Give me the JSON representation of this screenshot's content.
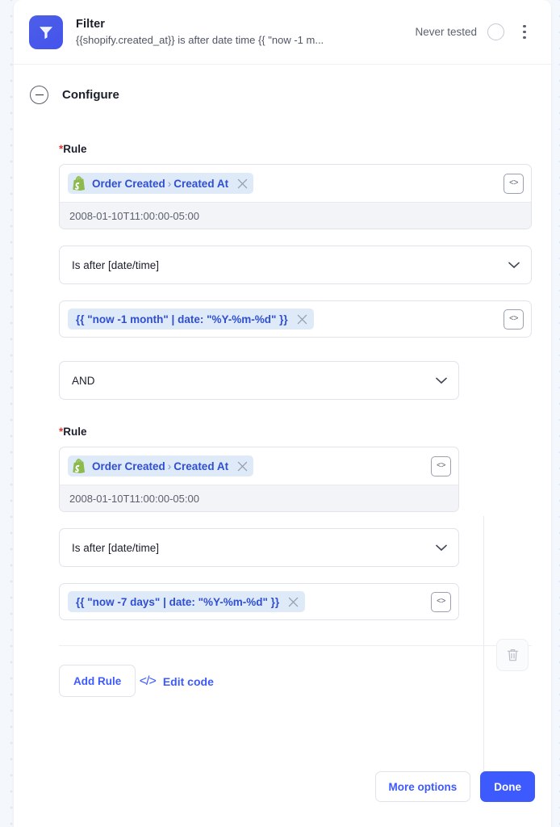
{
  "header": {
    "title": "Filter",
    "subtitle": "{{shopify.created_at}} is after date time {{ \"now -1 m...",
    "status": "Never tested",
    "app_icon": "filter-icon",
    "status_icon": "empty-circle-icon",
    "menu_icon": "kebab-menu-icon"
  },
  "section": {
    "title": "Configure",
    "collapse_icon": "circle-minus-icon"
  },
  "rules": [
    {
      "label": "Rule",
      "required_mark": "*",
      "source_icon": "shopify-icon",
      "token_prefix": "Order Created",
      "token_separator": "›",
      "token_suffix": "Created At",
      "remove_icon": "close-icon",
      "code_icon": "code-brackets-icon",
      "sample_value": "2008-01-10T11:00:00-05:00",
      "operator": "Is after [date/time]",
      "operator_chevron": "chevron-down-icon",
      "value_token": "{{ \"now -1 month\" | date: \"%Y-%m-%d\" }}",
      "value_remove_icon": "close-icon",
      "value_code_icon": "code-brackets-icon"
    },
    {
      "label": "Rule",
      "required_mark": "*",
      "source_icon": "shopify-icon",
      "token_prefix": "Order Created",
      "token_separator": "›",
      "token_suffix": "Created At",
      "remove_icon": "close-icon",
      "code_icon": "code-brackets-icon",
      "sample_value": "2008-01-10T11:00:00-05:00",
      "operator": "Is after [date/time]",
      "operator_chevron": "chevron-down-icon",
      "value_token": "{{ \"now -7 days\" | date: \"%Y-%m-%d\" }}",
      "value_remove_icon": "close-icon",
      "value_code_icon": "code-brackets-icon"
    }
  ],
  "logic": {
    "operator": "AND",
    "chevron": "chevron-down-icon"
  },
  "group_actions": {
    "delete_icon": "trash-icon"
  },
  "actions": {
    "add_rule": "Add Rule",
    "edit_code": "Edit code",
    "edit_code_icon": "code-angle-icon",
    "more_options": "More options",
    "done": "Done"
  },
  "colors": {
    "accent_blue": "#3d5afe",
    "token_blue": "#2f4fd0",
    "token_bg": "#dfeaf9",
    "shopify_green": "#7cb342",
    "required_red": "#e0382b",
    "app_icon_bg": "#4453ec"
  }
}
